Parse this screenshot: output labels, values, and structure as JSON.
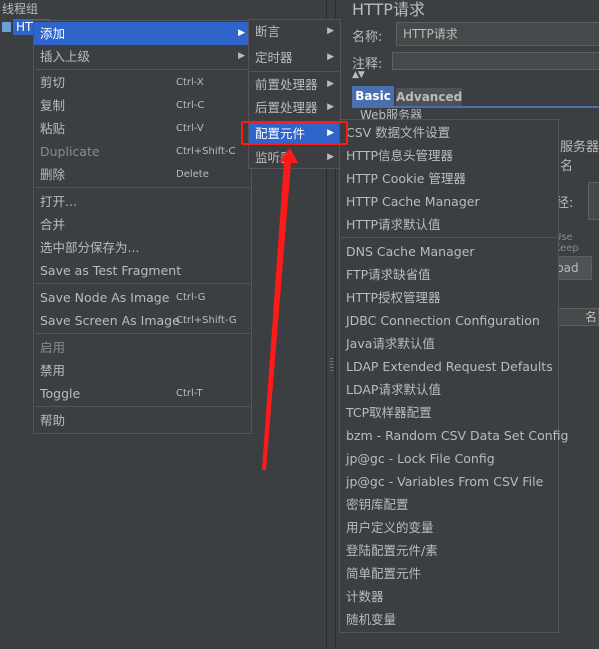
{
  "tree": {
    "root_label": "线程组",
    "node_label": "HTTP"
  },
  "right_panel": {
    "title": "HTTP请求",
    "name_label": "名称:",
    "name_value": "HTTP请求",
    "comment_label": "注释:",
    "collapse_glyph": "▲▼",
    "tabs": {
      "basic": "Basic",
      "advanced": "Advanced"
    },
    "web_server_label": "Web服务器",
    "server_label": "服务器名",
    "path_label": "径:",
    "keep_alive": "Use Keep",
    "load_tab": "load",
    "column_header": "名"
  },
  "context_menu": {
    "items": [
      {
        "label": "添加",
        "shortcut": "",
        "submenu": true,
        "highlighted": true,
        "disabled": false
      },
      {
        "label": "插入上级",
        "shortcut": "",
        "submenu": true,
        "highlighted": false,
        "disabled": false
      },
      {
        "label": "剪切",
        "shortcut": "Ctrl-X",
        "submenu": false,
        "highlighted": false,
        "disabled": false
      },
      {
        "label": "复制",
        "shortcut": "Ctrl-C",
        "submenu": false,
        "highlighted": false,
        "disabled": false
      },
      {
        "label": "粘贴",
        "shortcut": "Ctrl-V",
        "submenu": false,
        "highlighted": false,
        "disabled": false
      },
      {
        "label": "Duplicate",
        "shortcut": "Ctrl+Shift-C",
        "submenu": false,
        "highlighted": false,
        "disabled": true
      },
      {
        "label": "删除",
        "shortcut": "Delete",
        "submenu": false,
        "highlighted": false,
        "disabled": false
      },
      {
        "label": "打开...",
        "shortcut": "",
        "submenu": false,
        "highlighted": false,
        "disabled": false
      },
      {
        "label": "合并",
        "shortcut": "",
        "submenu": false,
        "highlighted": false,
        "disabled": false
      },
      {
        "label": "选中部分保存为...",
        "shortcut": "",
        "submenu": false,
        "highlighted": false,
        "disabled": false
      },
      {
        "label": "Save as Test Fragment",
        "shortcut": "",
        "submenu": false,
        "highlighted": false,
        "disabled": false
      },
      {
        "label": "Save Node As Image",
        "shortcut": "Ctrl-G",
        "submenu": false,
        "highlighted": false,
        "disabled": false
      },
      {
        "label": "Save Screen As Image",
        "shortcut": "Ctrl+Shift-G",
        "submenu": false,
        "highlighted": false,
        "disabled": false
      },
      {
        "label": "启用",
        "shortcut": "",
        "submenu": false,
        "highlighted": false,
        "disabled": true
      },
      {
        "label": "禁用",
        "shortcut": "",
        "submenu": false,
        "highlighted": false,
        "disabled": false
      },
      {
        "label": "Toggle",
        "shortcut": "Ctrl-T",
        "submenu": false,
        "highlighted": false,
        "disabled": false
      },
      {
        "label": "帮助",
        "shortcut": "",
        "submenu": false,
        "highlighted": false,
        "disabled": false
      }
    ]
  },
  "add_submenu": {
    "items": [
      {
        "label": "断言",
        "highlighted": false
      },
      {
        "label": "定时器",
        "highlighted": false
      },
      {
        "label": "前置处理器",
        "highlighted": false
      },
      {
        "label": "后置处理器",
        "highlighted": false
      },
      {
        "label": "配置元件",
        "highlighted": true
      },
      {
        "label": "监听器",
        "highlighted": false
      }
    ]
  },
  "config_submenu": {
    "items": [
      "CSV 数据文件设置",
      "HTTP信息头管理器",
      "HTTP Cookie 管理器",
      "HTTP Cache Manager",
      "HTTP请求默认值",
      "DNS Cache Manager",
      "FTP请求缺省值",
      "HTTP授权管理器",
      "JDBC Connection Configuration",
      "Java请求默认值",
      "LDAP Extended Request Defaults",
      "LDAP请求默认值",
      "TCP取样器配置",
      "bzm - Random CSV Data Set Config",
      "jp@gc - Lock File Config",
      "jp@gc - Variables From CSV File",
      "密钥库配置",
      "用户定义的变量",
      "登陆配置元件/素",
      "简单配置元件",
      "计数器",
      "随机变量"
    ]
  },
  "colors": {
    "highlight": "#2f65ca",
    "annotation": "#ff1a1a",
    "background": "#3c3f41"
  }
}
